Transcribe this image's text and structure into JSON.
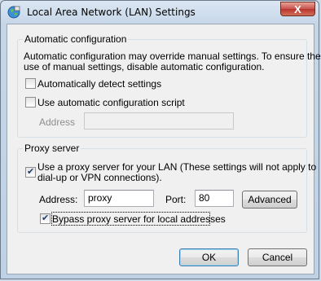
{
  "window": {
    "title": "Local Area Network (LAN) Settings",
    "close_glyph": "X",
    "icon": "network-globe-icon"
  },
  "auto_config": {
    "legend": "Automatic configuration",
    "description_line1": "Automatic configuration may override manual settings.  To ensure the",
    "description_line2": "use of manual settings, disable automatic configuration.",
    "detect_label": "Automatically detect settings",
    "detect_checked": false,
    "script_label": "Use automatic configuration script",
    "script_checked": false,
    "address_label": "Address",
    "address_value": ""
  },
  "proxy": {
    "legend": "Proxy server",
    "use_proxy_line1": "Use a proxy server for your LAN (These settings will not apply to",
    "use_proxy_line2": "dial-up or VPN connections).",
    "use_proxy_checked": true,
    "address_label": "Address:",
    "address_value": "proxy",
    "port_label": "Port:",
    "port_value": "80",
    "advanced_label": "Advanced",
    "bypass_label": "Bypass proxy server for local addresses",
    "bypass_checked": true
  },
  "footer": {
    "ok_label": "OK",
    "cancel_label": "Cancel"
  },
  "colors": {
    "accent": "#3c7fb1",
    "close_button": "#c75050"
  }
}
